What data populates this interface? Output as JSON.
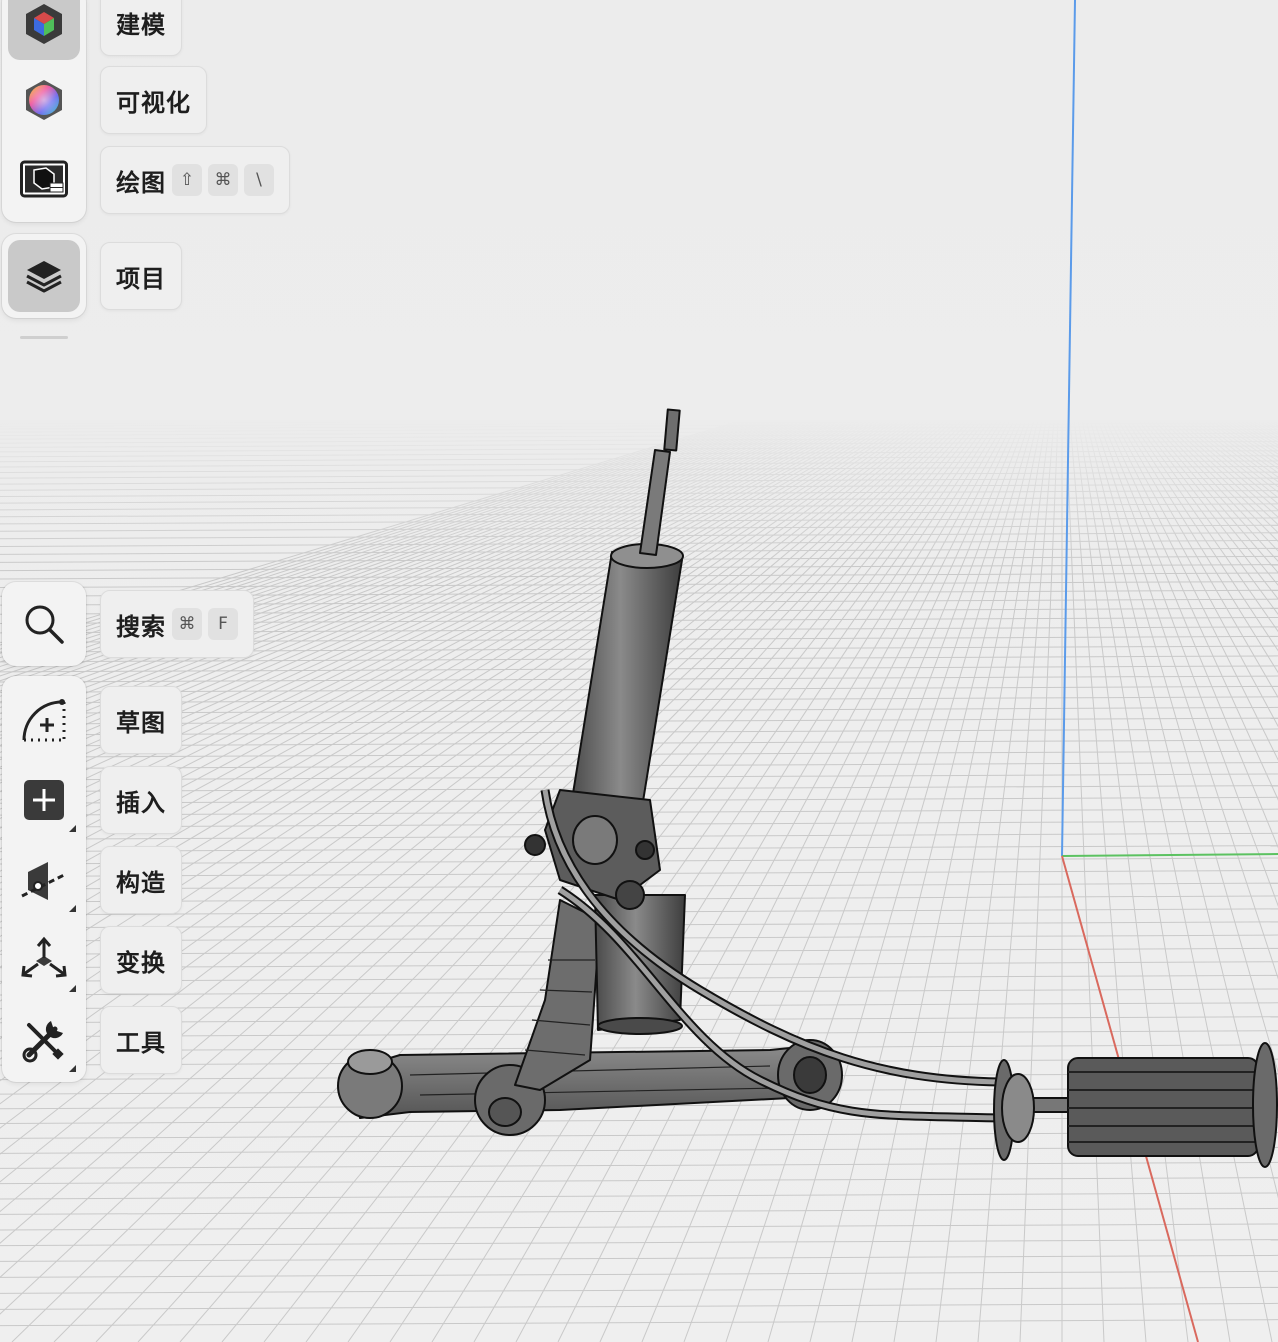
{
  "colors": {
    "axis_x": "#d9695e",
    "axis_y": "#5cc261",
    "axis_z": "#5b9bea",
    "panel_bg": "#f3f3f3",
    "active_bg": "#c9c9c9"
  },
  "workspace_menu": [
    {
      "label": "建模",
      "icon": "modeling-cube-icon",
      "shortcut": []
    },
    {
      "label": "可视化",
      "icon": "visualization-color-wheel-icon",
      "shortcut": []
    },
    {
      "label": "绘图",
      "icon": "drawing-sheet-icon",
      "shortcut": [
        "⇧",
        "⌘",
        "\\"
      ]
    }
  ],
  "project_menu": {
    "label": "项目",
    "icon": "layers-icon"
  },
  "search": {
    "label": "搜索",
    "icon": "search-icon",
    "shortcut": [
      "⌘",
      "F"
    ]
  },
  "tools": [
    {
      "label": "草图",
      "icon": "sketch-arc-icon"
    },
    {
      "label": "插入",
      "icon": "insert-plus-icon"
    },
    {
      "label": "构造",
      "icon": "construct-plane-icon"
    },
    {
      "label": "变换",
      "icon": "transform-arrows-icon"
    },
    {
      "label": "工具",
      "icon": "tools-wrench-icon"
    }
  ],
  "viewport": {
    "model": "suspension-assembly",
    "grid": true
  }
}
